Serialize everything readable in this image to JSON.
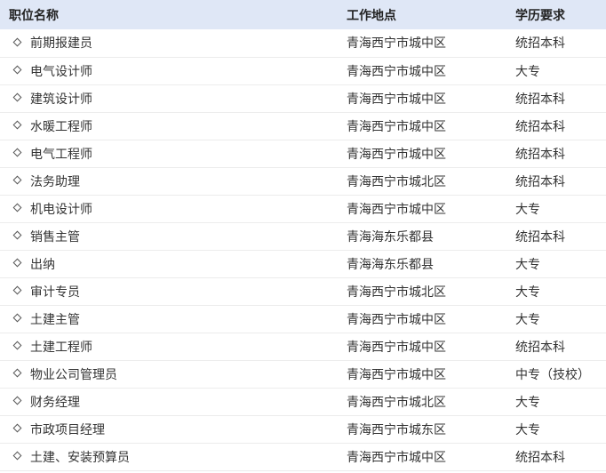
{
  "table": {
    "headers": {
      "title": "职位名称",
      "location": "工作地点",
      "education": "学历要求"
    },
    "rows": [
      {
        "title": "前期报建员",
        "location": "青海西宁市城中区",
        "education": "统招本科"
      },
      {
        "title": "电气设计师",
        "location": "青海西宁市城中区",
        "education": "大专"
      },
      {
        "title": "建筑设计师",
        "location": "青海西宁市城中区",
        "education": "统招本科"
      },
      {
        "title": "水暖工程师",
        "location": "青海西宁市城中区",
        "education": "统招本科"
      },
      {
        "title": "电气工程师",
        "location": "青海西宁市城中区",
        "education": "统招本科"
      },
      {
        "title": "法务助理",
        "location": "青海西宁市城北区",
        "education": "统招本科"
      },
      {
        "title": "机电设计师",
        "location": "青海西宁市城中区",
        "education": "大专"
      },
      {
        "title": "销售主管",
        "location": "青海海东乐都县",
        "education": "统招本科"
      },
      {
        "title": "出纳",
        "location": "青海海东乐都县",
        "education": "大专"
      },
      {
        "title": "审计专员",
        "location": "青海西宁市城北区",
        "education": "大专"
      },
      {
        "title": "土建主管",
        "location": "青海西宁市城中区",
        "education": "大专"
      },
      {
        "title": "土建工程师",
        "location": "青海西宁市城中区",
        "education": "统招本科"
      },
      {
        "title": "物业公司管理员",
        "location": "青海西宁市城中区",
        "education": "中专（技校）"
      },
      {
        "title": "财务经理",
        "location": "青海西宁市城北区",
        "education": "大专"
      },
      {
        "title": "市政项目经理",
        "location": "青海西宁市城东区",
        "education": "大专"
      },
      {
        "title": "土建、安装预算员",
        "location": "青海西宁市城中区",
        "education": "统招本科"
      }
    ]
  },
  "colors": {
    "header_background": "#dfe7f6",
    "text": "#333333",
    "row_divider": "#ececec"
  },
  "icons": {
    "row_marker": "diamond-icon"
  }
}
